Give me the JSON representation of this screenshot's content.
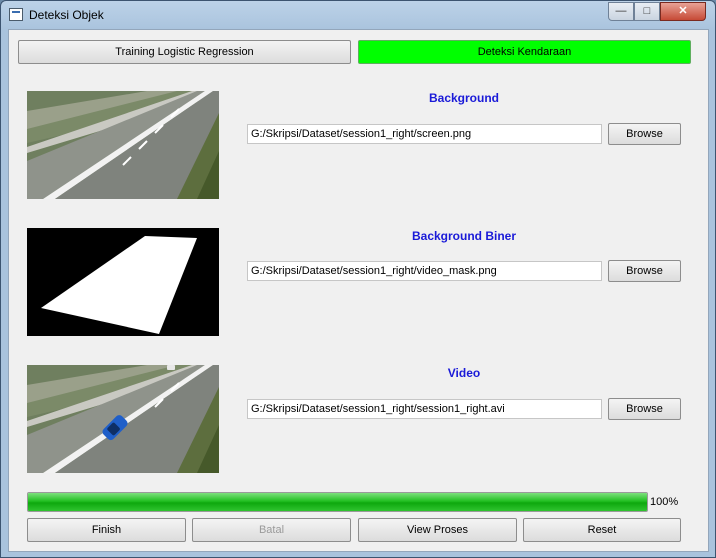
{
  "window": {
    "title": "Deteksi Objek"
  },
  "top_buttons": {
    "training": "Training Logistic Regression",
    "deteksi": "Deteksi Kendaraan"
  },
  "sections": [
    {
      "label": "Background",
      "path": "G:/Skripsi/Dataset/session1_right/screen.png",
      "browse": "Browse"
    },
    {
      "label": "Background Biner",
      "path": "G:/Skripsi/Dataset/session1_right/video_mask.png",
      "browse": "Browse"
    },
    {
      "label": "Video",
      "path": "G:/Skripsi/Dataset/session1_right/session1_right.avi",
      "browse": "Browse"
    }
  ],
  "progress": {
    "value": 1.0,
    "text": "100%"
  },
  "bottom_buttons": {
    "finish": "Finish",
    "batal": "Batal",
    "view": "View Proses",
    "reset": "Reset"
  },
  "colors": {
    "accent_green": "#00ff00",
    "label_blue": "#1a1ad8"
  }
}
